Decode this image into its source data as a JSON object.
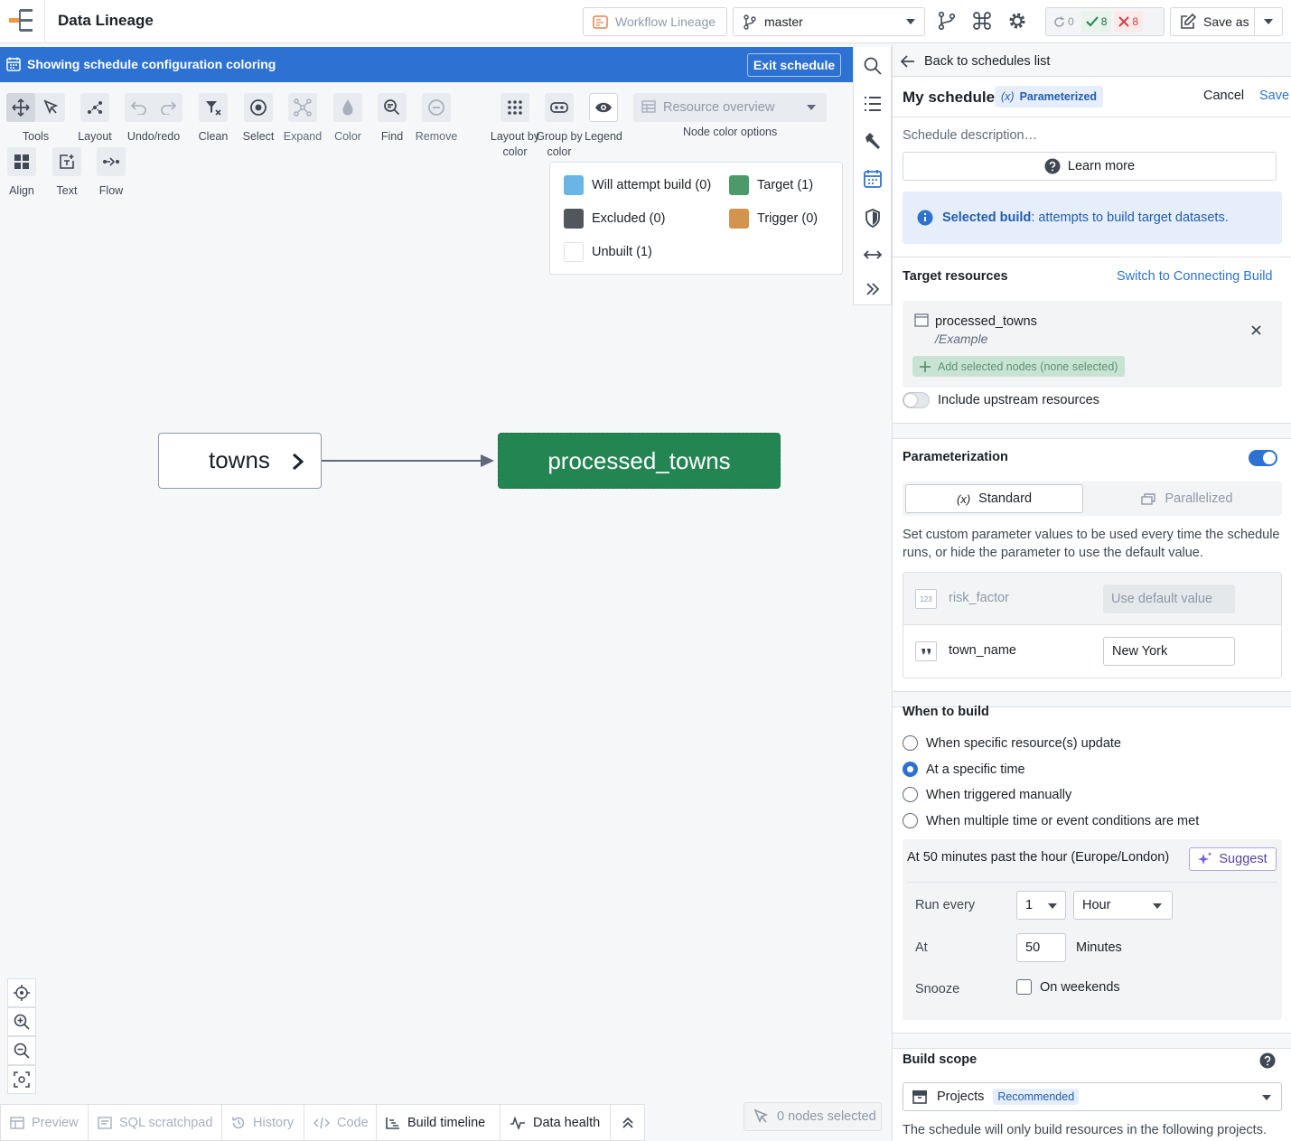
{
  "app": {
    "title": "Data Lineage"
  },
  "topbar": {
    "workflow_label": "Workflow Lineage",
    "branch": "master",
    "status": {
      "running": "0",
      "success": "8",
      "failed": "8"
    },
    "save_as_label": "Save as"
  },
  "banner": {
    "text": "Showing schedule configuration coloring",
    "exit_label": "Exit schedule"
  },
  "toolbar": {
    "tools": "Tools",
    "layout": "Layout",
    "undo_redo": "Undo/redo",
    "clean": "Clean",
    "select": "Select",
    "expand": "Expand",
    "color": "Color",
    "find": "Find",
    "remove": "Remove",
    "layout_by_color": "Layout by color",
    "group_by_color": "Group by color",
    "legend": "Legend",
    "align": "Align",
    "text": "Text",
    "flow": "Flow",
    "resource_overview": "Resource overview",
    "node_color_options": "Node color options"
  },
  "legend": {
    "items": [
      {
        "label": "Will attempt build (0)",
        "color": "#68b5e6"
      },
      {
        "label": "Target (1)",
        "color": "#4c9a6a"
      },
      {
        "label": "Excluded (0)",
        "color": "#52575e"
      },
      {
        "label": "Trigger (0)",
        "color": "#d39450"
      },
      {
        "label": "Unbuilt (1)",
        "color": "#ffffff"
      }
    ]
  },
  "graph": {
    "source_node": "towns",
    "target_node": "processed_towns"
  },
  "bottom_tabs": {
    "preview": "Preview",
    "sql": "SQL scratchpad",
    "history": "History",
    "code": "Code",
    "build_timeline": "Build timeline",
    "data_health": "Data health"
  },
  "nodes_selected": "0 nodes selected",
  "panel": {
    "back_label": "Back to schedules list",
    "schedule_name": "My schedule",
    "parameterized_badge": "Parameterized",
    "param_glyph": "(x)",
    "cancel_label": "Cancel",
    "save_label": "Save",
    "description_placeholder": "Schedule description…",
    "learn_more": "Learn more",
    "info_bold": "Selected build",
    "info_rest": ": attempts to build target datasets.",
    "target_resources_title": "Target resources",
    "switch_link": "Switch to Connecting Build",
    "resource_name": "processed_towns",
    "resource_path": "/Example",
    "add_selected": "Add selected nodes (none selected)",
    "include_upstream": "Include upstream resources",
    "parameterization_title": "Parameterization",
    "mode_standard": "Standard",
    "mode_parallelized": "Parallelized",
    "param_help": "Set custom parameter values to be used every time the schedule runs, or hide the parameter to use the default value.",
    "params": [
      {
        "type_badge": "123",
        "name": "risk_factor",
        "value": "Use default value"
      },
      {
        "type_badge": "99",
        "name": "town_name",
        "value": "New York"
      }
    ],
    "when_title": "When to build",
    "when_options": [
      "When specific resource(s) update",
      "At a specific time",
      "When triggered manually",
      "When multiple time or event conditions are met"
    ],
    "when_selected_index": 1,
    "time_summary": "At 50 minutes past the hour (Europe/London)",
    "suggest_label": "Suggest",
    "run_every_label": "Run every",
    "run_every_value": "1",
    "run_every_unit": "Hour",
    "at_label": "At",
    "at_value": "50",
    "minutes_label": "Minutes",
    "snooze_label": "Snooze",
    "on_weekends": "On weekends",
    "build_scope_title": "Build scope",
    "scope_value": "Projects",
    "scope_badge": "Recommended",
    "scope_help": "The schedule will only build resources in the following projects."
  }
}
